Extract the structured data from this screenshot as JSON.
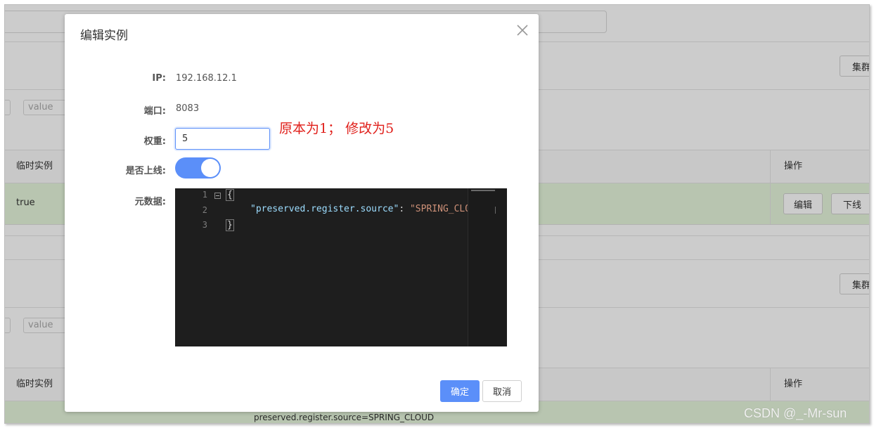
{
  "background": {
    "cluster_button_label": "集群",
    "value_placeholder": "value",
    "table_headers": {
      "ephemeral": "临时实例",
      "operations": "操作"
    },
    "row1": {
      "ephemeral": "true",
      "edit_label": "编辑",
      "offline_label": "下线"
    },
    "row2": {
      "metadata": "preserved.register.source=SPRING_CLOUD"
    }
  },
  "dialog": {
    "title": "编辑实例",
    "ip_label": "IP:",
    "ip_value": "192.168.12.1",
    "port_label": "端口:",
    "port_value": "8083",
    "weight_label": "权重:",
    "weight_value": "5",
    "online_label": "是否上线:",
    "online_enabled": true,
    "metadata_label": "元数据:",
    "editor": {
      "line_numbers": [
        "1",
        "2",
        "3"
      ],
      "line1": "{",
      "line2_key": "\"preserved.register.source\"",
      "line2_sep": ": ",
      "line2_value": "\"SPRING_CLOUD\"",
      "line3": "}"
    },
    "ok_label": "确定",
    "cancel_label": "取消"
  },
  "annotation": "原本为1；  修改为5",
  "watermark": "CSDN @_-Mr-sun",
  "colors": {
    "primary": "#5b8ff9",
    "annotation": "#e0201b",
    "editor_bg": "#1e1e1e",
    "row_highlight": "#e6f7dc"
  },
  "icons": {
    "close": "close-icon",
    "fold": "fold-minus-icon"
  }
}
